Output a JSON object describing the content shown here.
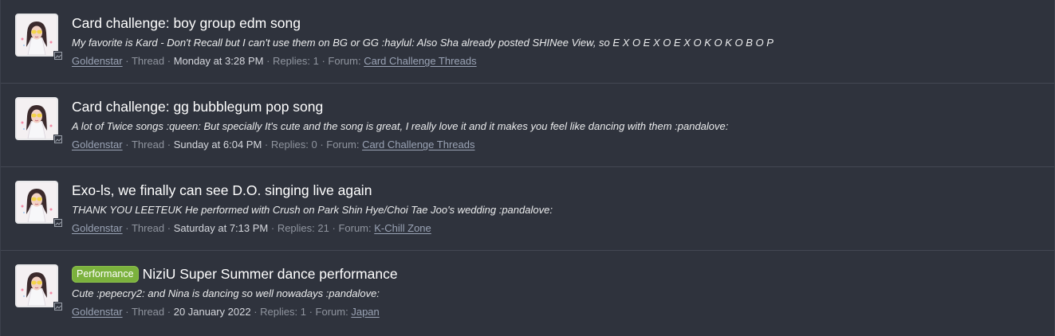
{
  "threads": [
    {
      "prefix": "",
      "title": "Card challenge: boy group edm song",
      "snippet": "My favorite is Kard - Don't Recall but I can't use them on BG or GG :haylul: Also Sha already posted SHINee View, so E X O E X O E X O K O K O B O P",
      "author": "Goldenstar",
      "type": "Thread",
      "time": "Monday at 3:28 PM",
      "replies": "Replies: 1",
      "forum_label": "Forum:",
      "forum": "Card Challenge Threads"
    },
    {
      "prefix": "",
      "title": "Card challenge: gg bubblegum pop song",
      "snippet": "A lot of Twice songs :queen: But specially It's cute and the song is great, I really love it and it makes you feel like dancing with them :pandalove:",
      "author": "Goldenstar",
      "type": "Thread",
      "time": "Sunday at 6:04 PM",
      "replies": "Replies: 0",
      "forum_label": "Forum:",
      "forum": "Card Challenge Threads"
    },
    {
      "prefix": "",
      "title": "Exo-ls, we finally can see D.O. singing live again",
      "snippet": "THANK YOU LEETEUK He performed with Crush on Park Shin Hye/Choi Tae Joo's wedding :pandalove:",
      "author": "Goldenstar",
      "type": "Thread",
      "time": "Saturday at 7:13 PM",
      "replies": "Replies: 21",
      "forum_label": "Forum:",
      "forum": "K-Chill Zone"
    },
    {
      "prefix": "Performance",
      "title": "NiziU Super Summer dance performance",
      "snippet": "Cute :pepecry2: and Nina is dancing so well nowadays :pandalove:",
      "author": "Goldenstar",
      "type": "Thread",
      "time": "20 January 2022",
      "replies": "Replies: 1",
      "forum_label": "Forum:",
      "forum": "Japan"
    }
  ],
  "icons": {
    "avatar": "user-avatar-image",
    "badge": "gallery-icon"
  },
  "colors": {
    "background": "#2f333d",
    "prefix_badge": "#7bb13d",
    "link": "#9aa3b5"
  }
}
